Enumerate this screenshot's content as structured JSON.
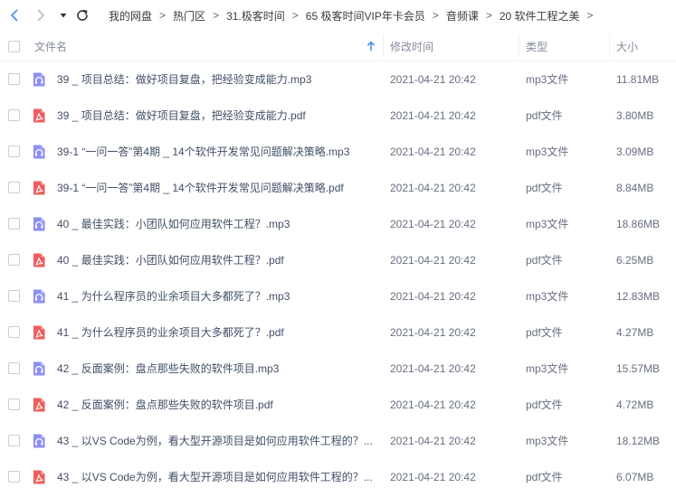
{
  "breadcrumb": [
    "我的网盘",
    "热门区",
    "31.极客时间",
    "65 极客时间VIP年卡会员",
    "音频课",
    "20 软件工程之美"
  ],
  "columns": {
    "name": "文件名",
    "modified": "修改时间",
    "type": "类型",
    "size": "大小"
  },
  "colors": {
    "accent": "#3e8ef7",
    "audio_icon": "#8c8ff5",
    "pdf_icon": "#f25c5c"
  },
  "files": [
    {
      "name": "39 _ 项目总结：做好项目复盘，把经验变成能力.mp3",
      "modified": "2021-04-21 20:42",
      "type": "mp3文件",
      "size": "11.81MB",
      "icon": "audio-file-icon"
    },
    {
      "name": "39 _ 项目总结：做好项目复盘，把经验变成能力.pdf",
      "modified": "2021-04-21 20:42",
      "type": "pdf文件",
      "size": "3.80MB",
      "icon": "pdf-file-icon"
    },
    {
      "name": "39-1 “一问一答”第4期 _ 14个软件开发常见问题解决策略.mp3",
      "modified": "2021-04-21 20:42",
      "type": "mp3文件",
      "size": "3.09MB",
      "icon": "audio-file-icon"
    },
    {
      "name": "39-1 “一问一答”第4期 _ 14个软件开发常见问题解决策略.pdf",
      "modified": "2021-04-21 20:42",
      "type": "pdf文件",
      "size": "8.84MB",
      "icon": "pdf-file-icon"
    },
    {
      "name": "40 _ 最佳实践：小团队如何应用软件工程？.mp3",
      "modified": "2021-04-21 20:42",
      "type": "mp3文件",
      "size": "18.86MB",
      "icon": "audio-file-icon"
    },
    {
      "name": "40 _ 最佳实践：小团队如何应用软件工程？.pdf",
      "modified": "2021-04-21 20:42",
      "type": "pdf文件",
      "size": "6.25MB",
      "icon": "pdf-file-icon"
    },
    {
      "name": "41 _ 为什么程序员的业余项目大多都死了？.mp3",
      "modified": "2021-04-21 20:42",
      "type": "mp3文件",
      "size": "12.83MB",
      "icon": "audio-file-icon"
    },
    {
      "name": "41 _ 为什么程序员的业余项目大多都死了？.pdf",
      "modified": "2021-04-21 20:42",
      "type": "pdf文件",
      "size": "4.27MB",
      "icon": "pdf-file-icon"
    },
    {
      "name": "42 _ 反面案例：盘点那些失败的软件项目.mp3",
      "modified": "2021-04-21 20:42",
      "type": "mp3文件",
      "size": "15.57MB",
      "icon": "audio-file-icon"
    },
    {
      "name": "42 _ 反面案例：盘点那些失败的软件项目.pdf",
      "modified": "2021-04-21 20:42",
      "type": "pdf文件",
      "size": "4.72MB",
      "icon": "pdf-file-icon"
    },
    {
      "name": "43 _ 以VS Code为例，看大型开源项目是如何应用软件工程的？...",
      "modified": "2021-04-21 20:42",
      "type": "mp3文件",
      "size": "18.12MB",
      "icon": "audio-file-icon"
    },
    {
      "name": "43 _ 以VS Code为例，看大型开源项目是如何应用软件工程的？...",
      "modified": "2021-04-21 20:42",
      "type": "pdf文件",
      "size": "6.07MB",
      "icon": "pdf-file-icon"
    }
  ]
}
